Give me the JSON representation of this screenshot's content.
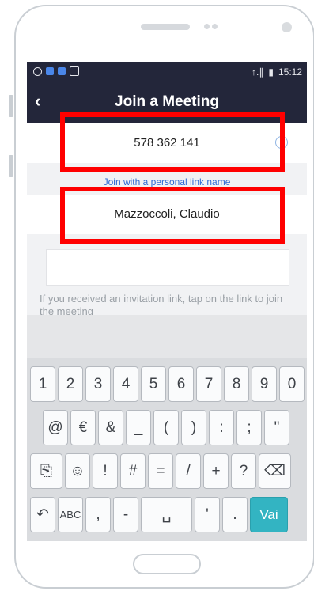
{
  "status_bar": {
    "time": "15:12",
    "signal": "↑.∥",
    "battery": "▮"
  },
  "header": {
    "back": "‹",
    "title": "Join a Meeting"
  },
  "form": {
    "meeting_id": "578 362 141",
    "personal_link": "Join with a personal link name",
    "name": "Mazzoccoli, Claudio",
    "hint": "If you received an invitation link, tap on the link to join the meeting"
  },
  "keyboard": {
    "row1": [
      "1",
      "2",
      "3",
      "4",
      "5",
      "6",
      "7",
      "8",
      "9",
      "0"
    ],
    "row2": [
      "@",
      "€",
      "&",
      "_",
      "(",
      ")",
      ":",
      ";",
      "\""
    ],
    "row3": [
      "⎘",
      "☺",
      "!",
      "#",
      "=",
      "/",
      "+",
      "?",
      "⌫"
    ],
    "row4": [
      "↶",
      "ABC",
      ",",
      "-",
      "␣",
      "'",
      ".",
      "Vai"
    ]
  },
  "colors": {
    "header_bg": "#23263a",
    "accent": "#33b4c2",
    "highlight": "#ff0000",
    "link": "#2f6bd5"
  }
}
